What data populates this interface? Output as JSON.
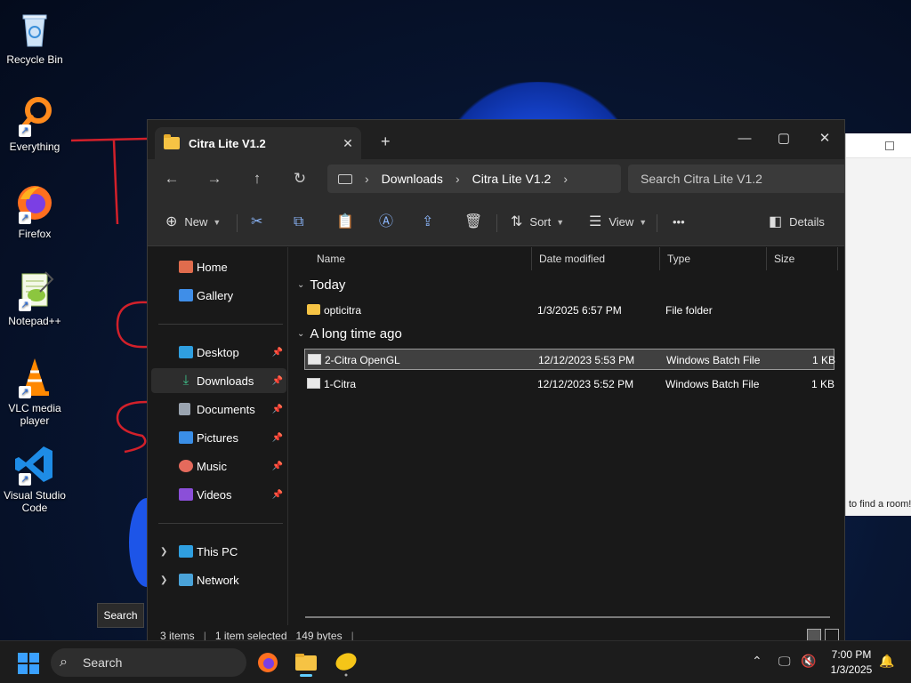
{
  "desktop": {
    "icons": [
      {
        "label": "Recycle Bin"
      },
      {
        "label": "Everything"
      },
      {
        "label": "Firefox"
      },
      {
        "label": "Notepad++"
      },
      {
        "label": "VLC media player"
      },
      {
        "label": "Visual Studio Code"
      }
    ],
    "bg_window_message": "to find a room!"
  },
  "explorer": {
    "tab_title": "Citra Lite V1.2",
    "window_controls": {
      "minimize": "—",
      "maximize": "▢",
      "close": "✕"
    },
    "breadcrumb": [
      "Downloads",
      "Citra Lite V1.2"
    ],
    "search_placeholder": "Search Citra Lite V1.2",
    "toolbar": {
      "new_label": "New",
      "sort_label": "Sort",
      "view_label": "View",
      "more_label": "•••",
      "details_label": "Details"
    },
    "nav": {
      "home": "Home",
      "gallery": "Gallery",
      "desktop": "Desktop",
      "downloads": "Downloads",
      "documents": "Documents",
      "pictures": "Pictures",
      "music": "Music",
      "videos": "Videos",
      "this_pc": "This PC",
      "network": "Network"
    },
    "columns": {
      "name": "Name",
      "date": "Date modified",
      "type": "Type",
      "size": "Size"
    },
    "groups": {
      "today": "Today",
      "long_ago": "A long time ago"
    },
    "files": [
      {
        "name": "opticitra",
        "date": "1/3/2025 6:57 PM",
        "type": "File folder",
        "size": ""
      },
      {
        "name": "2-Citra OpenGL",
        "date": "12/12/2023 5:53 PM",
        "type": "Windows Batch File",
        "size": "1 KB"
      },
      {
        "name": "1-Citra",
        "date": "12/12/2023 5:52 PM",
        "type": "Windows Batch File",
        "size": "1 KB"
      }
    ],
    "status": {
      "items": "3 items",
      "selected": "1 item selected",
      "size": "149 bytes"
    }
  },
  "tooltip": "Search",
  "taskbar": {
    "search_placeholder": "Search",
    "time": "7:00 PM",
    "date": "1/3/2025"
  }
}
